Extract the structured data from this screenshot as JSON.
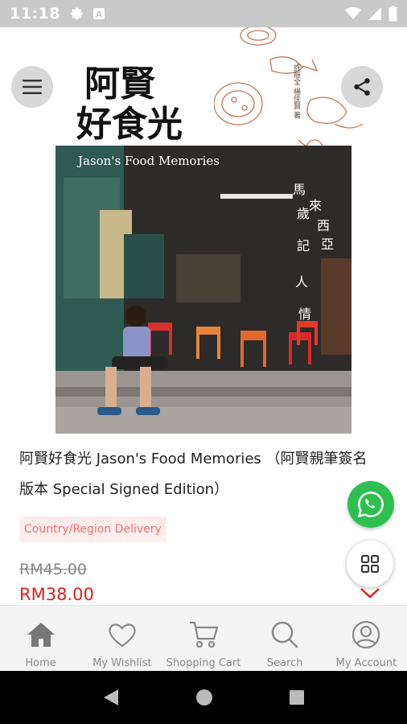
{
  "status_bar": {
    "time": "11:18",
    "icons": [
      "gear-icon",
      "a-box-icon",
      "wifi-icon",
      "signal-icon",
      "battery-icon"
    ]
  },
  "hero": {
    "cn_title_line1": "阿賢",
    "cn_title_line2": "好食光",
    "cover_en_title": "Jason's Food Memories",
    "cover_cn_text": "馬來西亞飲食的 歲月·記憶·人情味",
    "author_credit": "許振全 楊佳賢 著"
  },
  "product": {
    "title": "阿賢好食光 Jason's Food Memories （阿賢親筆簽名版本 Special Signed Edition）",
    "delivery_badge": "Country/Region Delivery",
    "old_price": "RM45.00",
    "new_price": "RM38.00"
  },
  "nav": {
    "items": [
      {
        "label": "Home",
        "icon": "home-icon"
      },
      {
        "label": "My Wishlist",
        "icon": "heart-icon"
      },
      {
        "label": "Shopping Cart",
        "icon": "cart-icon"
      },
      {
        "label": "Search",
        "icon": "search-icon"
      },
      {
        "label": "My Account",
        "icon": "account-icon"
      }
    ]
  },
  "colors": {
    "price_red": "#e02020",
    "badge_text": "#f07070",
    "badge_bg": "#fdeeee",
    "whatsapp_green": "#2fbf50",
    "nav_gray": "#888888"
  }
}
